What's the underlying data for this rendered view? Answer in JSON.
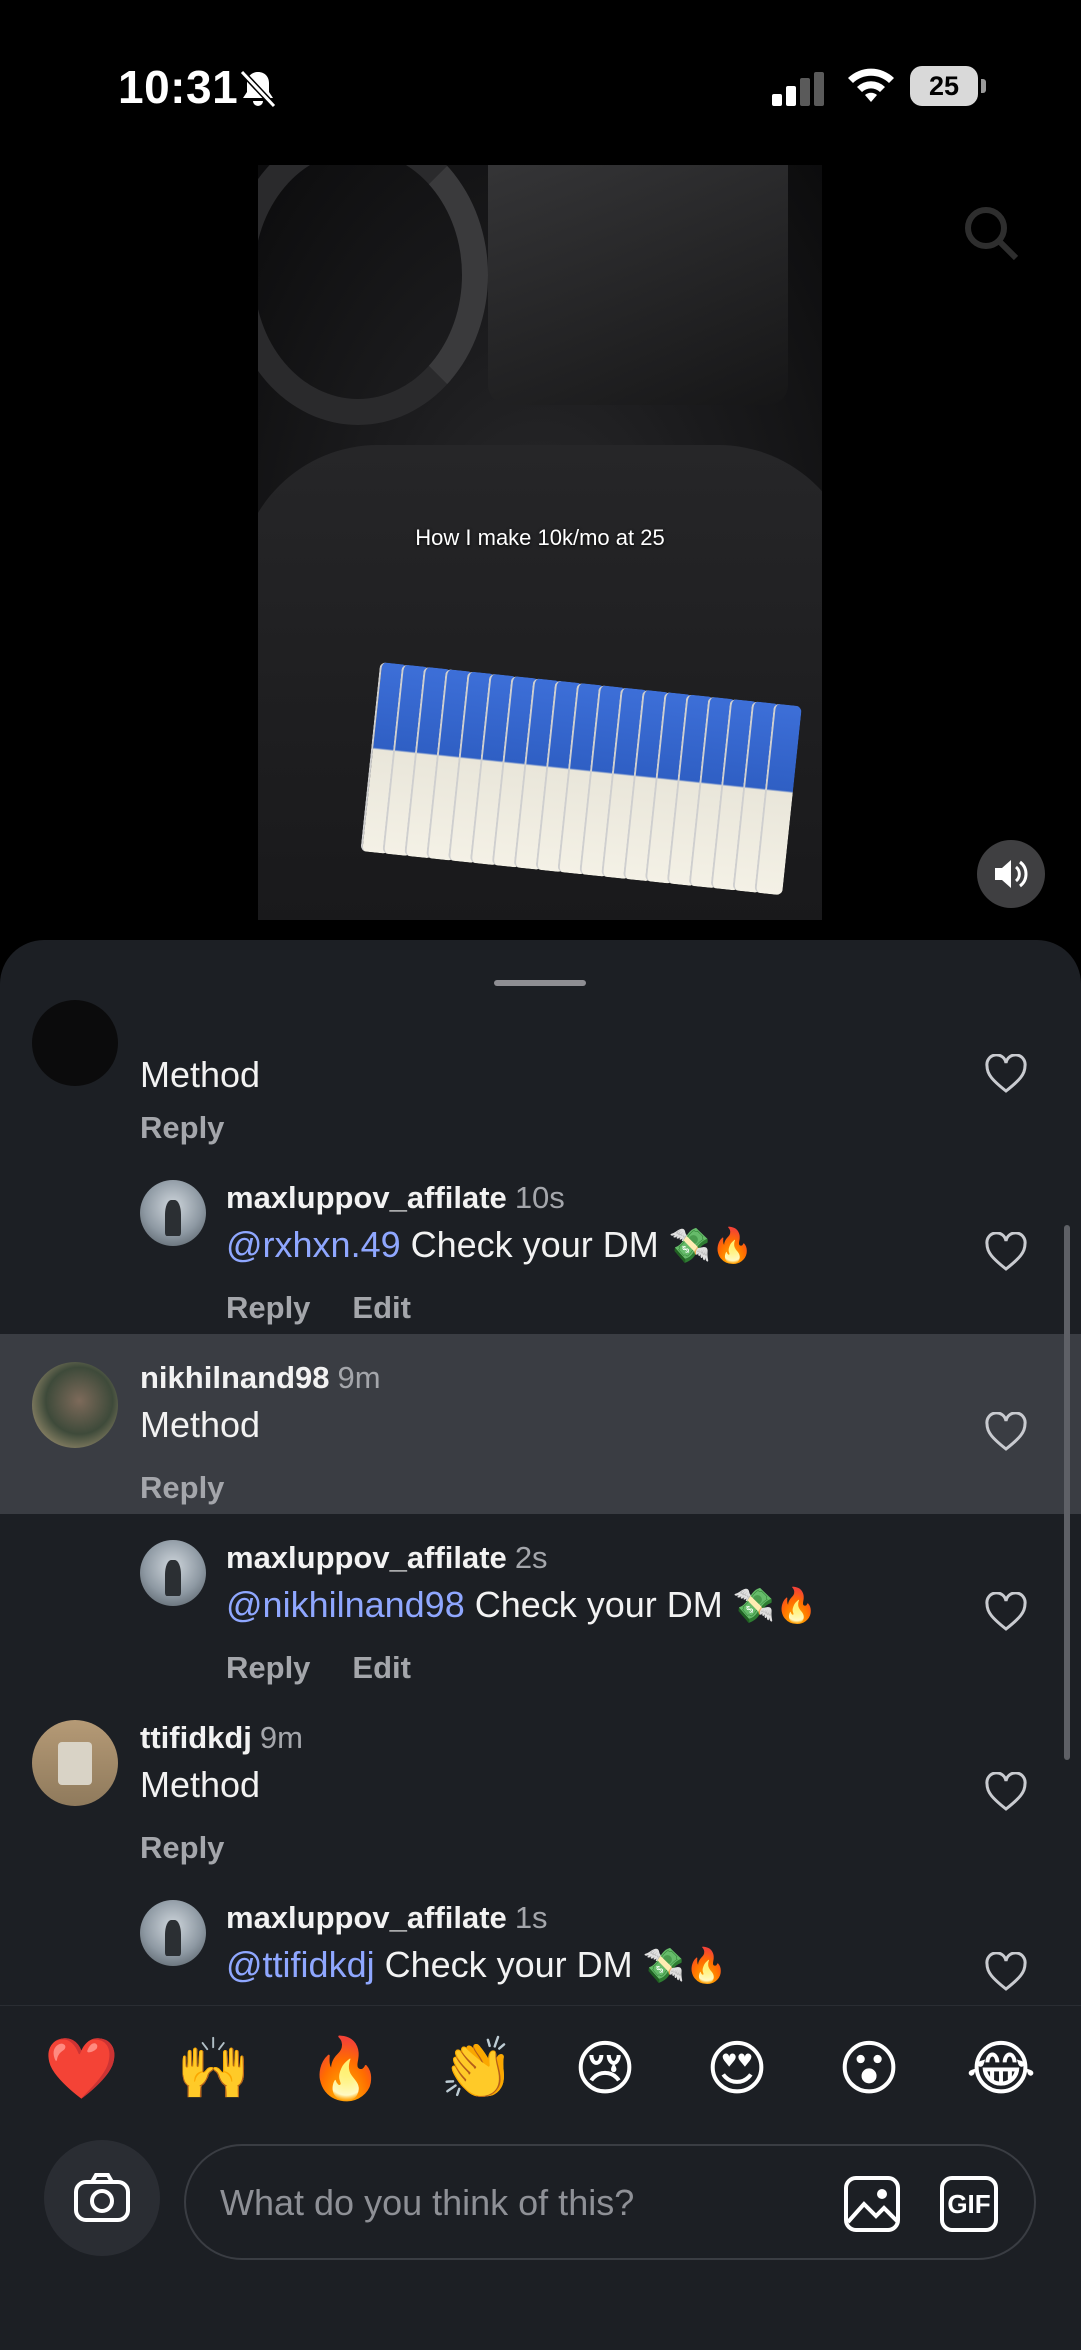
{
  "status_bar": {
    "time": "10:31",
    "battery": "25",
    "icons": [
      "bell-slash-icon",
      "cellular-signal-icon",
      "wifi-icon",
      "battery-icon"
    ]
  },
  "video": {
    "caption": "How I make 10k/mo at 25",
    "sound_icon": "speaker-icon"
  },
  "comments": [
    {
      "id": "c0",
      "text": "Method",
      "actions": [
        "Reply"
      ]
    },
    {
      "id": "r1",
      "username": "maxluppov_affilate",
      "age": "10s",
      "mention": "@rxhxn.49",
      "text": " Check your DM",
      "emojis": "💸🔥",
      "actions": [
        "Reply",
        "Edit"
      ]
    },
    {
      "id": "c2",
      "username": "nikhilnand98",
      "age": "9m",
      "text": "Method",
      "actions": [
        "Reply"
      ]
    },
    {
      "id": "r3",
      "username": "maxluppov_affilate",
      "age": "2s",
      "mention": "@nikhilnand98",
      "text": " Check your DM",
      "emojis": "💸🔥",
      "actions": [
        "Reply",
        "Edit"
      ]
    },
    {
      "id": "c4",
      "username": "ttifidkdj",
      "age": "9m",
      "text": "Method",
      "actions": [
        "Reply"
      ]
    },
    {
      "id": "r5",
      "username": "maxluppov_affilate",
      "age": "1s",
      "mention": "@ttifidkdj",
      "text": " Check your DM",
      "emojis": "💸🔥"
    }
  ],
  "reactions": [
    "❤️",
    "🙌",
    "🔥",
    "👏",
    "😢",
    "😍",
    "😮",
    "😂"
  ],
  "composer": {
    "placeholder": "What do you think of this?",
    "gif_label": "GIF"
  },
  "colors": {
    "sheet_background": "#1c1f24",
    "highlight_row": "#3a3d43",
    "mention": "#8fa7ff",
    "secondary_text": "#a4a6ab"
  }
}
